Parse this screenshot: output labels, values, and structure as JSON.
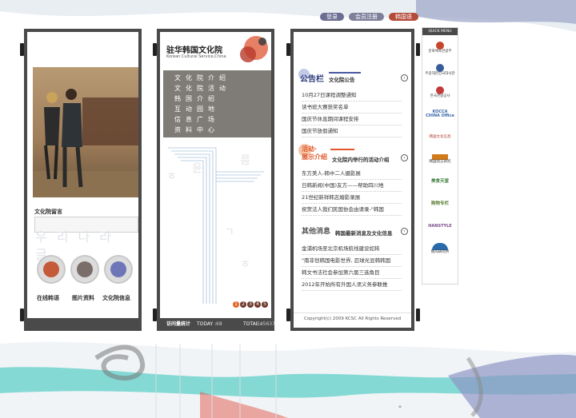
{
  "top_nav": [
    {
      "label": "登录",
      "color": "#6b6e92"
    },
    {
      "label": "会员注册",
      "color": "#7d7f9b"
    },
    {
      "label": "韩国语",
      "color": "#b54a3a"
    }
  ],
  "left_panel": {
    "board_title": "文化院留言",
    "bg_chars": [
      "우",
      "리",
      "나",
      "라",
      "글"
    ],
    "icons": [
      {
        "label": "在线韩语",
        "icon": "chat-bubble-icon"
      },
      {
        "label": "图片资料",
        "icon": "photo-frame-icon"
      },
      {
        "label": "文化院信息",
        "icon": "info-doc-icon"
      }
    ]
  },
  "middle_panel": {
    "title": "驻华韩国文化院",
    "subtitle": "Korean Cultural Service,China",
    "menu": [
      "文化院介绍",
      "文化院活动",
      "韩国介绍",
      "互动园地",
      "信息广场",
      "资料中心"
    ],
    "pages": [
      "1",
      "2",
      "3",
      "4",
      "5"
    ],
    "visitor_label": "访问量统计",
    "today_label": "TODAY :",
    "today_value": "68",
    "total_label": "TOTAL :",
    "total_value": "545637"
  },
  "right_panel": {
    "notice": {
      "title": "公告栏",
      "subtitle": "文化院公告",
      "items": [
        "10月27日课程调整通知",
        "读书班大赛获奖名单",
        "国庆节休息期间课程安排",
        "国庆节放假通知"
      ]
    },
    "activities": {
      "title_line1": "活动·",
      "title_line2": "展示介绍",
      "subtitle": "文化院内举行的活动介绍",
      "items": [
        "东方美人-韩中二人摄影展",
        "日韩新闻(中国)友方——帮助四川地",
        "21世纪新祥韩志婚影录展",
        "祝贺法人我们民国协会由请录-\"韩国"
      ]
    },
    "news": {
      "title": "其他消息",
      "subtitle": "韩国最新消息及文化信息",
      "items": [
        "金浦机场至北京机场航线建设如将",
        "\"南非恺韩国电影世界, 忍球光显韩韩国",
        "韩文书法社会参加第六届三选角目",
        "2012年开始所有外国人须义务参联推"
      ]
    },
    "copyright": "Copyright(c) 2009 KCSC All Rights Reserved"
  },
  "quick_menu": {
    "title": "QUICK MENU",
    "items": [
      {
        "label": "문화체육관광부",
        "color": "#c7452b"
      },
      {
        "label": "주중대한민국대사관",
        "color": "#3a5b9a"
      },
      {
        "label": "한국관광공사",
        "color": "#c23a3a"
      },
      {
        "label": "KOCCA CHINA Office",
        "color": "#3c6aa8"
      },
      {
        "label": "韩国文化信息",
        "color": "#b23a2a"
      },
      {
        "label": "韩国语言研究",
        "color": "#d27a1a"
      },
      {
        "label": "美食天堂",
        "color": "#3b7a3b"
      },
      {
        "label": "购物专栏",
        "color": "#5a7d2f"
      },
      {
        "label": "HANSTYLE",
        "color": "#7a4a8a"
      },
      {
        "label": "独岛研究所",
        "color": "#2a6aaa"
      }
    ]
  }
}
